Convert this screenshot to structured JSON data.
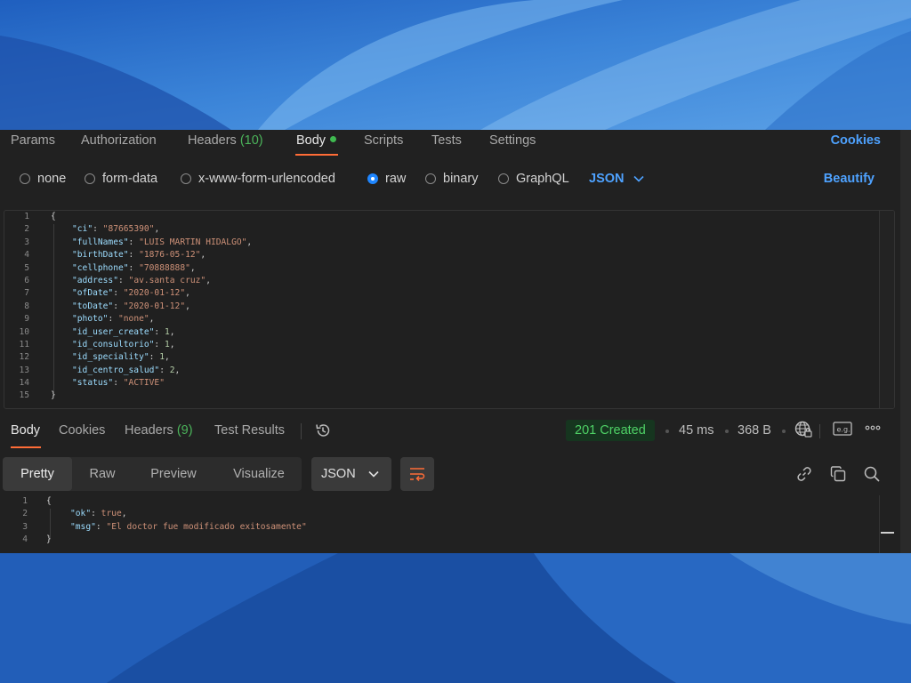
{
  "request_tabs": [
    {
      "label": "Params"
    },
    {
      "label": "Authorization"
    },
    {
      "label": "Headers",
      "count": "(10)"
    },
    {
      "label": "Body"
    },
    {
      "label": "Scripts"
    },
    {
      "label": "Tests"
    },
    {
      "label": "Settings"
    }
  ],
  "cookies_link": "Cookies",
  "body_types": [
    "none",
    "form-data",
    "x-www-form-urlencoded",
    "raw",
    "binary",
    "GraphQL"
  ],
  "selected_body_type": "raw",
  "raw_format": "JSON",
  "beautify_label": "Beautify",
  "request_body": {
    "line_numbers": [
      "1",
      "2",
      "3",
      "4",
      "5",
      "6",
      "7",
      "8",
      "9",
      "10",
      "11",
      "12",
      "13",
      "14",
      "15"
    ],
    "open_brace": "{",
    "close_brace": "}",
    "fields": [
      {
        "key": "\"ci\"",
        "value": "\"87665390\"",
        "sep": ","
      },
      {
        "key": "\"fullNames\"",
        "value": "\"LUIS MARTIN HIDALGO\"",
        "sep": ","
      },
      {
        "key": "\"birthDate\"",
        "value": "\"1876-05-12\"",
        "sep": ","
      },
      {
        "key": "\"cellphone\"",
        "value": "\"70888888\"",
        "sep": ","
      },
      {
        "key": "\"address\"",
        "value": "\"av.santa cruz\"",
        "sep": ","
      },
      {
        "key": "\"ofDate\"",
        "value": "\"2020-01-12\"",
        "sep": ","
      },
      {
        "key": "\"toDate\"",
        "value": "\"2020-01-12\"",
        "sep": ","
      },
      {
        "key": "\"photo\"",
        "value": "\"none\"",
        "sep": ","
      },
      {
        "key": "\"id_user_create\"",
        "value": "1",
        "sep": ","
      },
      {
        "key": "\"id_consultorio\"",
        "value": "1",
        "sep": ","
      },
      {
        "key": "\"id_speciality\"",
        "value": "1",
        "sep": ","
      },
      {
        "key": "\"id_centro_salud\"",
        "value": "2",
        "sep": ","
      },
      {
        "key": "\"status\"",
        "value": "\"ACTIVE\"",
        "sep": ""
      }
    ]
  },
  "response_tabs": [
    {
      "label": "Body"
    },
    {
      "label": "Cookies"
    },
    {
      "label": "Headers",
      "count": "(9)"
    },
    {
      "label": "Test Results"
    }
  ],
  "response_meta": {
    "status": "201 Created",
    "time": "45 ms",
    "size": "368 B"
  },
  "view_modes": [
    "Pretty",
    "Raw",
    "Preview",
    "Visualize"
  ],
  "active_view_mode": "Pretty",
  "response_format": "JSON",
  "response_body": {
    "line_numbers": [
      "1",
      "2",
      "3",
      "4"
    ],
    "open_brace": "{",
    "close_brace": "}",
    "fields": [
      {
        "key": "\"ok\"",
        "value": "true",
        "sep": ","
      },
      {
        "key": "\"msg\"",
        "value": "\"El doctor fue modificado exitosamente\"",
        "sep": ""
      }
    ]
  },
  "icons": {
    "history": "history-icon",
    "globe": "globe-icon",
    "example": "save-example-icon",
    "more": "more-icon",
    "wrap": "wrap-lines-icon",
    "link": "link-icon",
    "copy": "copy-icon",
    "search": "search-icon"
  },
  "colors": {
    "accent_orange": "#ff6c37",
    "link_blue": "#4ea2ff",
    "status_green": "#4fd266",
    "panel_bg": "#212121"
  }
}
